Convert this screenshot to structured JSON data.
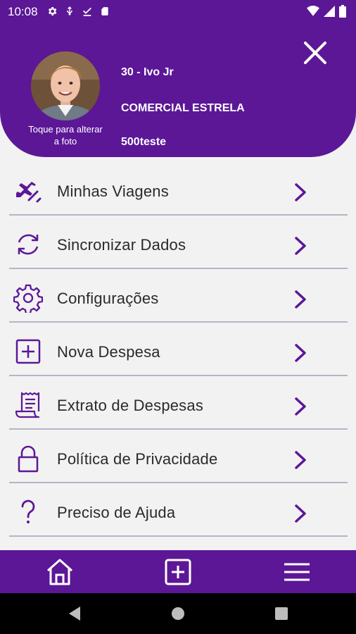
{
  "status_bar": {
    "time": "10:08",
    "left_icons": [
      "gear-icon",
      "usb-icon",
      "download-done-icon",
      "sd-card-icon"
    ],
    "right_icons": [
      "wifi-icon",
      "signal-icon",
      "battery-icon"
    ]
  },
  "header": {
    "avatar_caption": "Toque para alterar a foto",
    "user_id_name": "30 - Ivo Jr",
    "company": "COMERCIAL ESTRELA",
    "code": "500teste"
  },
  "menu": [
    {
      "label": "Minhas Viagens",
      "icon": "airplane-icon"
    },
    {
      "label": "Sincronizar Dados",
      "icon": "sync-icon"
    },
    {
      "label": "Configurações",
      "icon": "gear-icon"
    },
    {
      "label": "Nova Despesa",
      "icon": "add-box-icon"
    },
    {
      "label": "Extrato de Despesas",
      "icon": "receipt-icon"
    },
    {
      "label": "Política de Privacidade",
      "icon": "lock-icon"
    },
    {
      "label": "Preciso de Ajuda",
      "icon": "question-icon"
    }
  ],
  "bottom_nav": [
    "home-icon",
    "add-box-icon",
    "menu-icon"
  ],
  "colors": {
    "brand": "#5c1797",
    "icon": "#5c1797",
    "divider": "#b9b3c6",
    "background": "#f2f2f2"
  }
}
